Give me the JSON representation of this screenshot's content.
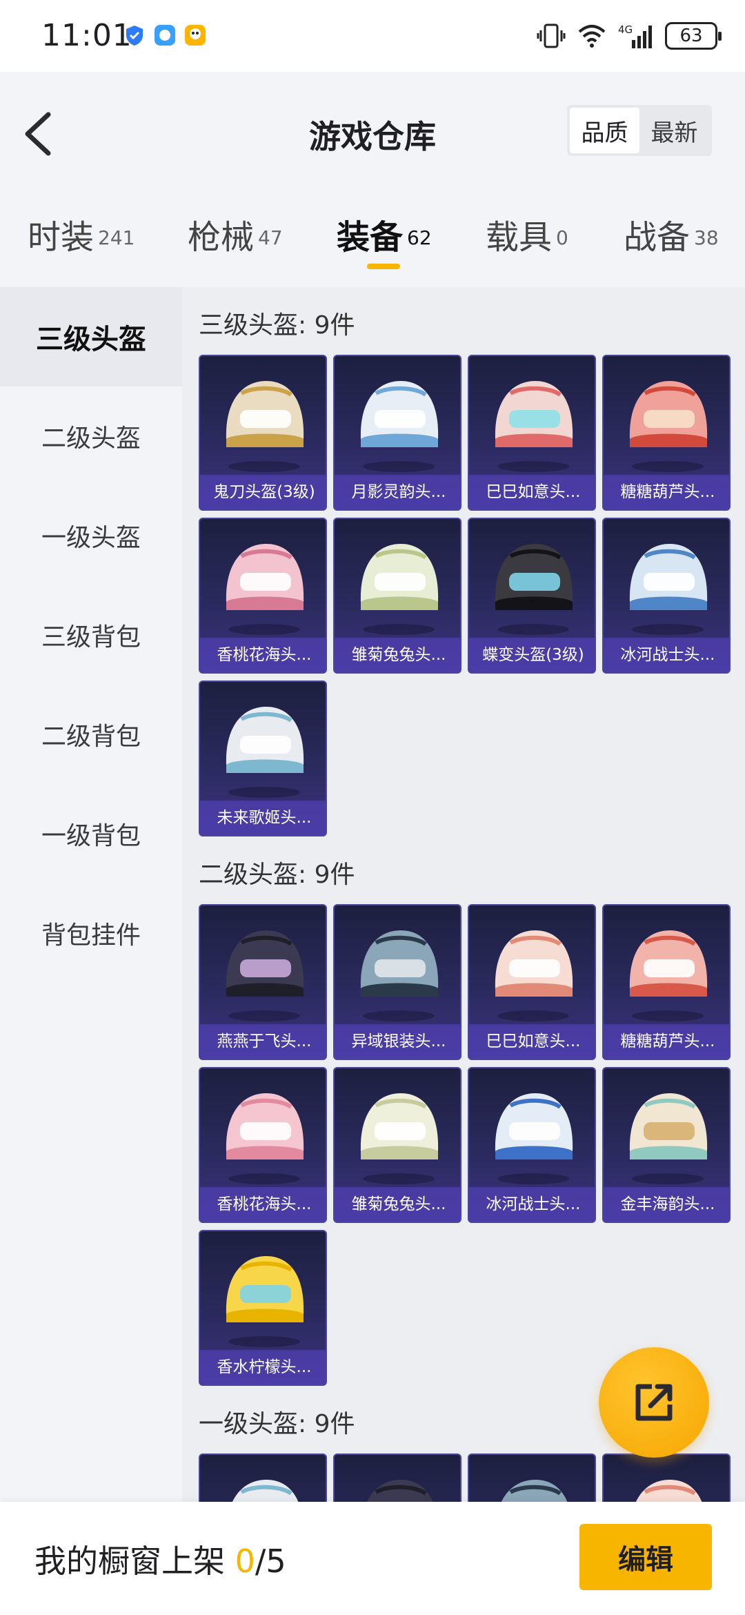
{
  "status_bar": {
    "time": "11:01",
    "battery": "63",
    "network": "4G"
  },
  "header": {
    "title": "游戏仓库",
    "sort_options": [
      "品质",
      "最新"
    ]
  },
  "tabs": [
    {
      "label": "时装",
      "count": "241"
    },
    {
      "label": "枪械",
      "count": "47"
    },
    {
      "label": "装备",
      "count": "62"
    },
    {
      "label": "载具",
      "count": "0"
    },
    {
      "label": "战备",
      "count": "38"
    }
  ],
  "sidebar": [
    "三级头盔",
    "二级头盔",
    "一级头盔",
    "三级背包",
    "二级背包",
    "一级背包",
    "背包挂件"
  ],
  "sections": [
    {
      "title": "三级头盔: 9件",
      "items": [
        "鬼刀头盔(3级)",
        "月影灵韵头...",
        "巳巳如意头...",
        "糖糖葫芦头...",
        "香桃花海头...",
        "雏菊兔兔头...",
        "蝶变头盔(3级)",
        "冰河战士头...",
        "未来歌姬头..."
      ]
    },
    {
      "title": "二级头盔: 9件",
      "items": [
        "燕燕于飞头...",
        "异域银装头...",
        "巳巳如意头...",
        "糖糖葫芦头...",
        "香桃花海头...",
        "雏菊兔兔头...",
        "冰河战士头...",
        "金丰海韵头...",
        "香水柠檬头..."
      ]
    },
    {
      "title": "一级头盔: 9件",
      "items": []
    }
  ],
  "bottom": {
    "label": "我的橱窗上架",
    "shelved": "0",
    "total": "/5",
    "edit": "编辑"
  },
  "colors": {
    "accent": "#f7b500",
    "card_bg": "#2b2a5e"
  }
}
